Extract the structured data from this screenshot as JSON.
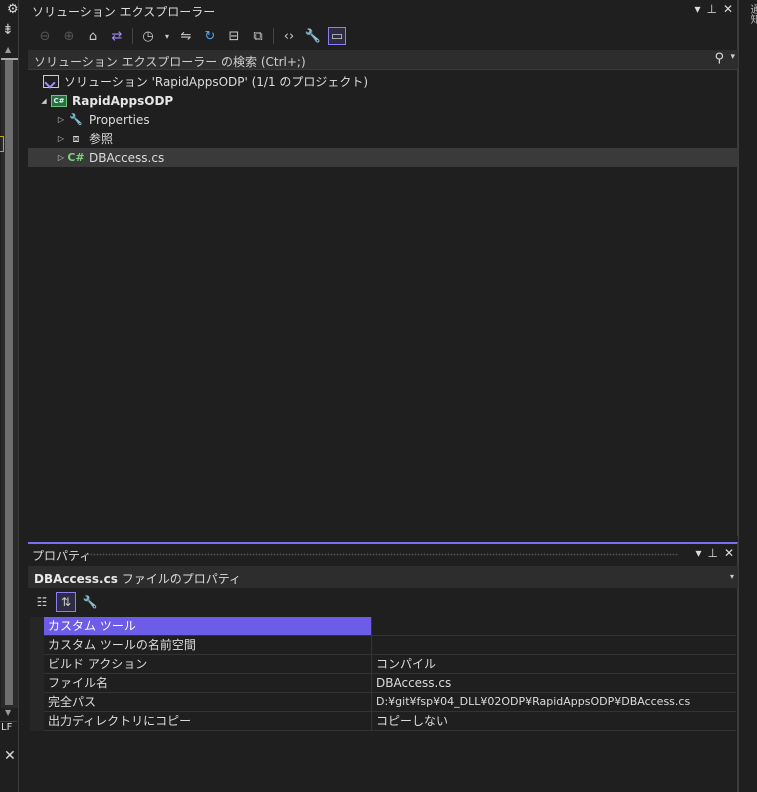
{
  "solution_explorer": {
    "title": "ソリューション エクスプローラー",
    "search_placeholder": "ソリューション エクスプローラー の検索 (Ctrl+;)",
    "tree": {
      "solution": "ソリューション 'RapidAppsODP' (1/1 のプロジェクト)",
      "project": "RapidAppsODP",
      "properties": "Properties",
      "references": "参照",
      "file": "DBAccess.cs"
    }
  },
  "properties_panel": {
    "title": "プロパティ",
    "object_file": "DBAccess.cs",
    "object_type": "ファイルのプロパティ",
    "rows": [
      {
        "name": "カスタム ツール",
        "value": ""
      },
      {
        "name": "カスタム ツールの名前空間",
        "value": ""
      },
      {
        "name": "ビルド アクション",
        "value": "コンパイル"
      },
      {
        "name": "ファイル名",
        "value": "DBAccess.cs"
      },
      {
        "name": "完全パス",
        "value": "D:¥git¥fsp¥04_DLL¥02ODP¥RapidAppsODP¥DBAccess.cs"
      },
      {
        "name": "出力ディレクトリにコピー",
        "value": "コピーしない"
      }
    ]
  },
  "editor": {
    "line_ending": "LF"
  },
  "icons": {
    "pin": "pin-icon",
    "close": "close-icon",
    "dropdown": "dropdown-icon"
  },
  "colors": {
    "accent": "#7b6cf6",
    "selection": "#6c5ce7"
  }
}
